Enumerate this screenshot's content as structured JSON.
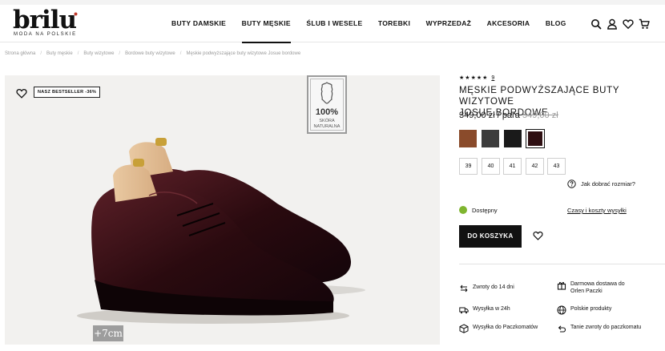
{
  "header": {
    "logo": "brilu",
    "logo_tagline": "MODA NA POLSKIE",
    "nav": [
      "BUTY DAMSKIE",
      "BUTY MĘSKIE",
      "ŚLUB I WESELE",
      "TOREBKI",
      "WYPRZEDAŻ",
      "AKCESORIA",
      "BLOG"
    ],
    "nav_active": "BUTY MĘSKIE",
    "icons": [
      "search-icon",
      "user-icon",
      "heart-icon",
      "cart-icon"
    ]
  },
  "breadcrumb": [
    "Strona główna",
    "Buty męskie",
    "Buty wizytowe",
    "Bordowe buty wizytowe",
    "Męskie podwyższające buty wizytowe Josue bordowe"
  ],
  "gallery": {
    "bestseller_badge": "NASZ BESTSELLER -36%",
    "leather_pct": "100%",
    "leather_line1": "SKÓRA",
    "leather_line2": "NATURALNA",
    "height_badge": "+7cm"
  },
  "product": {
    "stars": 5,
    "review_count": "9",
    "title_line1": "Męskie podwyższające buty wizytowe",
    "title_line2": "Josue bordowe",
    "price": "349,00 zł / para",
    "old_price": "549,00 zł",
    "swatches": [
      {
        "color": "#8a4b2b",
        "selected": false
      },
      {
        "color": "#3c3c3c",
        "selected": false
      },
      {
        "color": "#1a1a1a",
        "selected": false
      },
      {
        "color": "#2e0f12",
        "selected": true
      }
    ],
    "sizes": [
      "39",
      "40",
      "41",
      "42",
      "43"
    ],
    "size_guide": "Jak dobrać rozmiar?",
    "availability": "Dostępny",
    "availability_color": "#7fb52f",
    "shipping_link": "Czasy i koszty wysyłki",
    "add_to_cart": "DO KOSZYKA"
  },
  "features": {
    "returns": "Zwroty do 14 dni",
    "free_delivery_1": "Darmowa dostawa do",
    "free_delivery_2": "Orlen Paczki",
    "ship_24h": "Wysyłka w 24h",
    "polish": "Polskie produkty",
    "lockers": "Wysyłka do Paczkomatów",
    "cheap_returns": "Tanie zwroty do paczkomatu"
  }
}
